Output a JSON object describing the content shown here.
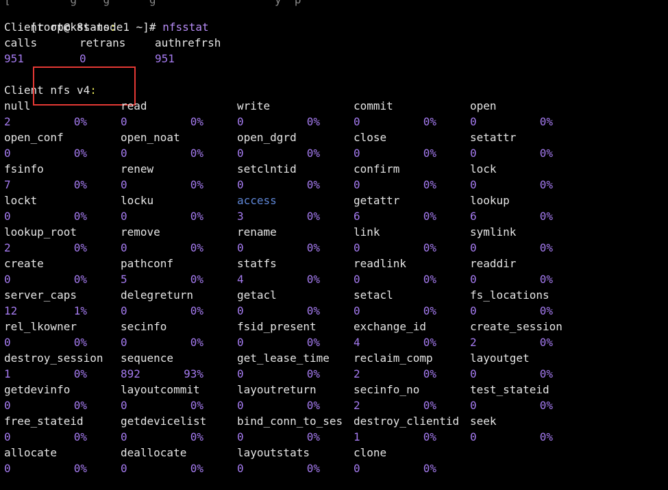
{
  "terminal": {
    "prompt": "[root@k8s-node1 ~]#",
    "command": "nfsstat",
    "top_cut_text": "[         g    g      g                  y  p"
  },
  "rpc": {
    "title": "Client rpc stats",
    "headers": [
      "calls",
      "retrans",
      "authrefrsh"
    ],
    "values": [
      "951",
      "0",
      "951"
    ]
  },
  "nfs": {
    "title": "Client nfs v4",
    "rows": [
      [
        [
          "null",
          "2",
          "0%"
        ],
        [
          "read",
          "0",
          "0%"
        ],
        [
          "write",
          "0",
          "0%"
        ],
        [
          "commit",
          "0",
          "0%"
        ],
        [
          "open",
          "0",
          "0%"
        ]
      ],
      [
        [
          "open_conf",
          "0",
          "0%"
        ],
        [
          "open_noat",
          "0",
          "0%"
        ],
        [
          "open_dgrd",
          "0",
          "0%"
        ],
        [
          "close",
          "0",
          "0%"
        ],
        [
          "setattr",
          "0",
          "0%"
        ]
      ],
      [
        [
          "fsinfo",
          "7",
          "0%"
        ],
        [
          "renew",
          "0",
          "0%"
        ],
        [
          "setclntid",
          "0",
          "0%"
        ],
        [
          "confirm",
          "0",
          "0%"
        ],
        [
          "lock",
          "0",
          "0%"
        ]
      ],
      [
        [
          "lockt",
          "0",
          "0%"
        ],
        [
          "locku",
          "0",
          "0%"
        ],
        [
          "access",
          "3",
          "0%"
        ],
        [
          "getattr",
          "6",
          "0%"
        ],
        [
          "lookup",
          "6",
          "0%"
        ]
      ],
      [
        [
          "lookup_root",
          "2",
          "0%"
        ],
        [
          "remove",
          "0",
          "0%"
        ],
        [
          "rename",
          "0",
          "0%"
        ],
        [
          "link",
          "0",
          "0%"
        ],
        [
          "symlink",
          "0",
          "0%"
        ]
      ],
      [
        [
          "create",
          "0",
          "0%"
        ],
        [
          "pathconf",
          "5",
          "0%"
        ],
        [
          "statfs",
          "4",
          "0%"
        ],
        [
          "readlink",
          "0",
          "0%"
        ],
        [
          "readdir",
          "0",
          "0%"
        ]
      ],
      [
        [
          "server_caps",
          "12",
          "1%"
        ],
        [
          "delegreturn",
          "0",
          "0%"
        ],
        [
          "getacl",
          "0",
          "0%"
        ],
        [
          "setacl",
          "0",
          "0%"
        ],
        [
          "fs_locations",
          "0",
          "0%"
        ]
      ],
      [
        [
          "rel_lkowner",
          "0",
          "0%"
        ],
        [
          "secinfo",
          "0",
          "0%"
        ],
        [
          "fsid_present",
          "0",
          "0%"
        ],
        [
          "exchange_id",
          "4",
          "0%"
        ],
        [
          "create_session",
          "2",
          "0%"
        ]
      ],
      [
        [
          "destroy_session",
          "1",
          "0%"
        ],
        [
          "sequence",
          "892",
          "93%"
        ],
        [
          "get_lease_time",
          "0",
          "0%"
        ],
        [
          "reclaim_comp",
          "2",
          "0%"
        ],
        [
          "layoutget",
          "0",
          "0%"
        ]
      ],
      [
        [
          "getdevinfo",
          "0",
          "0%"
        ],
        [
          "layoutcommit",
          "0",
          "0%"
        ],
        [
          "layoutreturn",
          "0",
          "0%"
        ],
        [
          "secinfo_no",
          "2",
          "0%"
        ],
        [
          "test_stateid",
          "0",
          "0%"
        ]
      ],
      [
        [
          "free_stateid",
          "0",
          "0%"
        ],
        [
          "getdevicelist",
          "0",
          "0%"
        ],
        [
          "bind_conn_to_ses",
          "0",
          "0%"
        ],
        [
          "destroy_clientid",
          "1",
          "0%"
        ],
        [
          "seek",
          "0",
          "0%"
        ]
      ],
      [
        [
          "allocate",
          "0",
          "0%"
        ],
        [
          "deallocate",
          "0",
          "0%"
        ],
        [
          "layoutstats",
          "0",
          "0%"
        ],
        [
          "clone",
          "0",
          "0%"
        ]
      ]
    ]
  },
  "colors": {
    "background": "#000000",
    "text": "#e6e6e6",
    "number": "#a57bf0",
    "command": "#b88df8",
    "highlight": "#5f87d7",
    "colon": "#e8e85a",
    "annotation_box": "#e53935"
  }
}
